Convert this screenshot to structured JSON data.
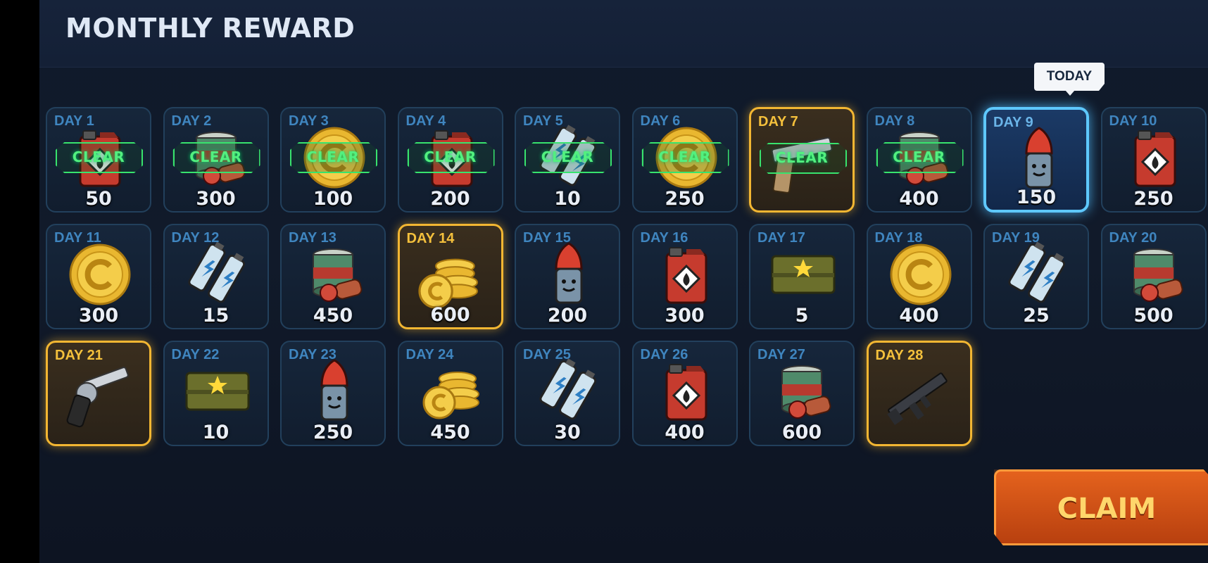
{
  "header": {
    "title": "MONTHLY REWARD"
  },
  "today_badge": "TODAY",
  "clear_label": "CLEAR",
  "claim_label": "CLAIM",
  "colors": {
    "accent_gold": "#f2b632",
    "today_blue": "#5ec8ff",
    "clear_green": "#38e36d",
    "claim_orange": "#e4621d"
  },
  "days": [
    {
      "day": "DAY 1",
      "amount": "50",
      "item": "fuel-can-icon",
      "claimed": true,
      "special": false
    },
    {
      "day": "DAY 2",
      "amount": "300",
      "item": "food-can-icon",
      "claimed": true,
      "special": false
    },
    {
      "day": "DAY 3",
      "amount": "100",
      "item": "gold-coin-icon",
      "claimed": true,
      "special": false
    },
    {
      "day": "DAY 4",
      "amount": "200",
      "item": "fuel-can-icon",
      "claimed": true,
      "special": false
    },
    {
      "day": "DAY 5",
      "amount": "10",
      "item": "battery-icon",
      "claimed": true,
      "special": false
    },
    {
      "day": "DAY 6",
      "amount": "250",
      "item": "gold-coin-icon",
      "claimed": true,
      "special": false
    },
    {
      "day": "DAY 7",
      "amount": "",
      "item": "pistol-icon",
      "claimed": true,
      "special": true
    },
    {
      "day": "DAY 8",
      "amount": "400",
      "item": "food-can-icon",
      "claimed": true,
      "special": false
    },
    {
      "day": "DAY 9",
      "amount": "150",
      "item": "bullet-icon",
      "claimed": false,
      "special": false,
      "today": true
    },
    {
      "day": "DAY 10",
      "amount": "250",
      "item": "fuel-can-icon",
      "claimed": false,
      "special": false
    },
    {
      "day": "DAY 11",
      "amount": "300",
      "item": "gold-coin-icon",
      "claimed": false,
      "special": false
    },
    {
      "day": "DAY 12",
      "amount": "15",
      "item": "battery-icon",
      "claimed": false,
      "special": false
    },
    {
      "day": "DAY 13",
      "amount": "450",
      "item": "food-can-icon",
      "claimed": false,
      "special": false
    },
    {
      "day": "DAY 14",
      "amount": "600",
      "item": "coin-stack-icon",
      "claimed": false,
      "special": true
    },
    {
      "day": "DAY 15",
      "amount": "200",
      "item": "bullet-icon",
      "claimed": false,
      "special": false
    },
    {
      "day": "DAY 16",
      "amount": "300",
      "item": "fuel-can-icon",
      "claimed": false,
      "special": false
    },
    {
      "day": "DAY 17",
      "amount": "5",
      "item": "ammo-crate-icon",
      "claimed": false,
      "special": false
    },
    {
      "day": "DAY 18",
      "amount": "400",
      "item": "gold-coin-icon",
      "claimed": false,
      "special": false
    },
    {
      "day": "DAY 19",
      "amount": "25",
      "item": "battery-icon",
      "claimed": false,
      "special": false
    },
    {
      "day": "DAY 20",
      "amount": "500",
      "item": "food-can-icon",
      "claimed": false,
      "special": false
    },
    {
      "day": "DAY 21",
      "amount": "",
      "item": "revolver-icon",
      "claimed": false,
      "special": true
    },
    {
      "day": "DAY 22",
      "amount": "10",
      "item": "ammo-crate-icon",
      "claimed": false,
      "special": false
    },
    {
      "day": "DAY 23",
      "amount": "250",
      "item": "bullet-icon",
      "claimed": false,
      "special": false
    },
    {
      "day": "DAY 24",
      "amount": "450",
      "item": "coin-stack-icon",
      "claimed": false,
      "special": false
    },
    {
      "day": "DAY 25",
      "amount": "30",
      "item": "battery-icon",
      "claimed": false,
      "special": false
    },
    {
      "day": "DAY 26",
      "amount": "400",
      "item": "fuel-can-icon",
      "claimed": false,
      "special": false
    },
    {
      "day": "DAY 27",
      "amount": "600",
      "item": "food-can-icon",
      "claimed": false,
      "special": false
    },
    {
      "day": "DAY 28",
      "amount": "",
      "item": "assault-rifle-icon",
      "claimed": false,
      "special": true
    }
  ]
}
